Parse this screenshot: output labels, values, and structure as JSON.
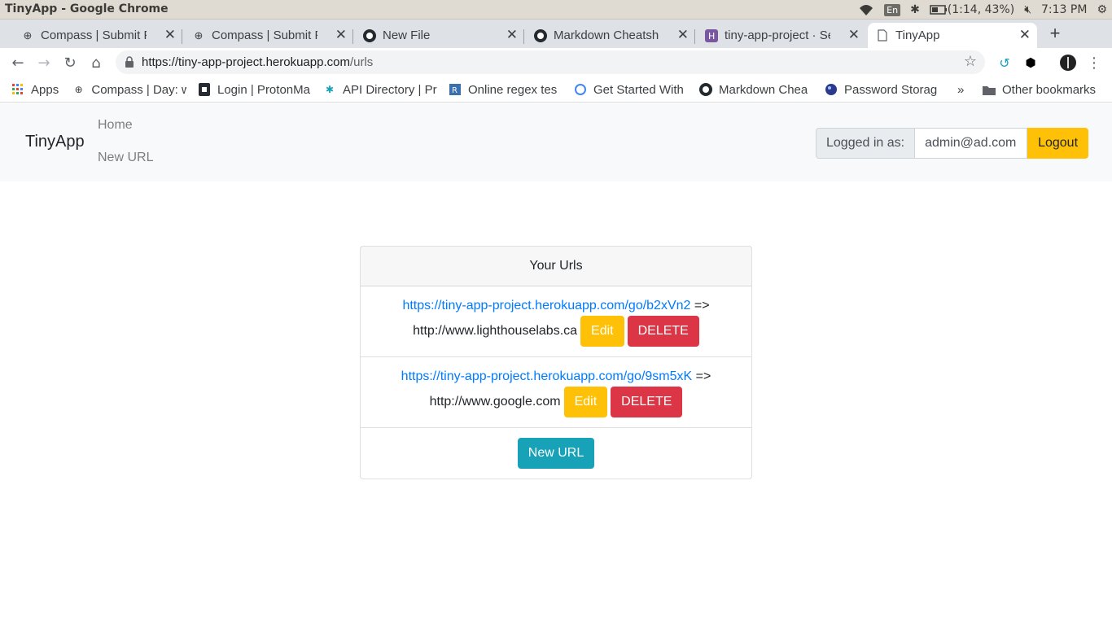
{
  "os": {
    "window_title": "TinyApp - Google Chrome",
    "lang": "En",
    "battery": "(1:14, 43%)",
    "time": "7:13 PM"
  },
  "tabs": [
    {
      "label": "Compass | Submit Pro",
      "icon": "compass-icon"
    },
    {
      "label": "Compass | Submit Pro",
      "icon": "compass-icon"
    },
    {
      "label": "New File",
      "icon": "github-icon"
    },
    {
      "label": "Markdown Cheatshee",
      "icon": "github-icon"
    },
    {
      "label": "tiny-app-project · Sett",
      "icon": "heroku-icon"
    },
    {
      "label": "TinyApp",
      "icon": "page-icon"
    }
  ],
  "address": {
    "host": "https://tiny-app-project.herokuapp.com",
    "path": "/urls"
  },
  "bookmarks": [
    {
      "label": "Apps",
      "icon": "apps-grid-icon"
    },
    {
      "label": "Compass | Day: w",
      "icon": "compass-icon"
    },
    {
      "label": "Login | ProtonMa",
      "icon": "protonmail-icon"
    },
    {
      "label": "API Directory | Pr",
      "icon": "api-icon"
    },
    {
      "label": "Online regex tes",
      "icon": "regex-icon"
    },
    {
      "label": "Get Started With",
      "icon": "google-icon"
    },
    {
      "label": "Markdown Chea",
      "icon": "github-icon"
    },
    {
      "label": "Password Storag",
      "icon": "globe-icon"
    },
    {
      "label": "»",
      "icon": "chevron-right-icon"
    },
    {
      "label": "Other bookmarks",
      "icon": "folder-icon"
    }
  ],
  "navbar": {
    "brand": "TinyApp",
    "home": "Home",
    "new_url": "New URL",
    "logged_in_label": "Logged in as:",
    "email": "admin@ad.com",
    "logout": "Logout"
  },
  "card": {
    "header": "Your Urls",
    "arrow": "=>",
    "edit_label": "Edit",
    "delete_label": "DELETE",
    "new_url_label": "New URL",
    "urls": [
      {
        "short": "https://tiny-app-project.herokuapp.com/go/b2xVn2",
        "long": "http://www.lighthouselabs.ca"
      },
      {
        "short": "https://tiny-app-project.herokuapp.com/go/9sm5xK",
        "long": "http://www.google.com"
      }
    ]
  },
  "colors": {
    "link": "#007bff",
    "warning": "#ffc107",
    "danger": "#dc3545",
    "info": "#17a2b8"
  }
}
